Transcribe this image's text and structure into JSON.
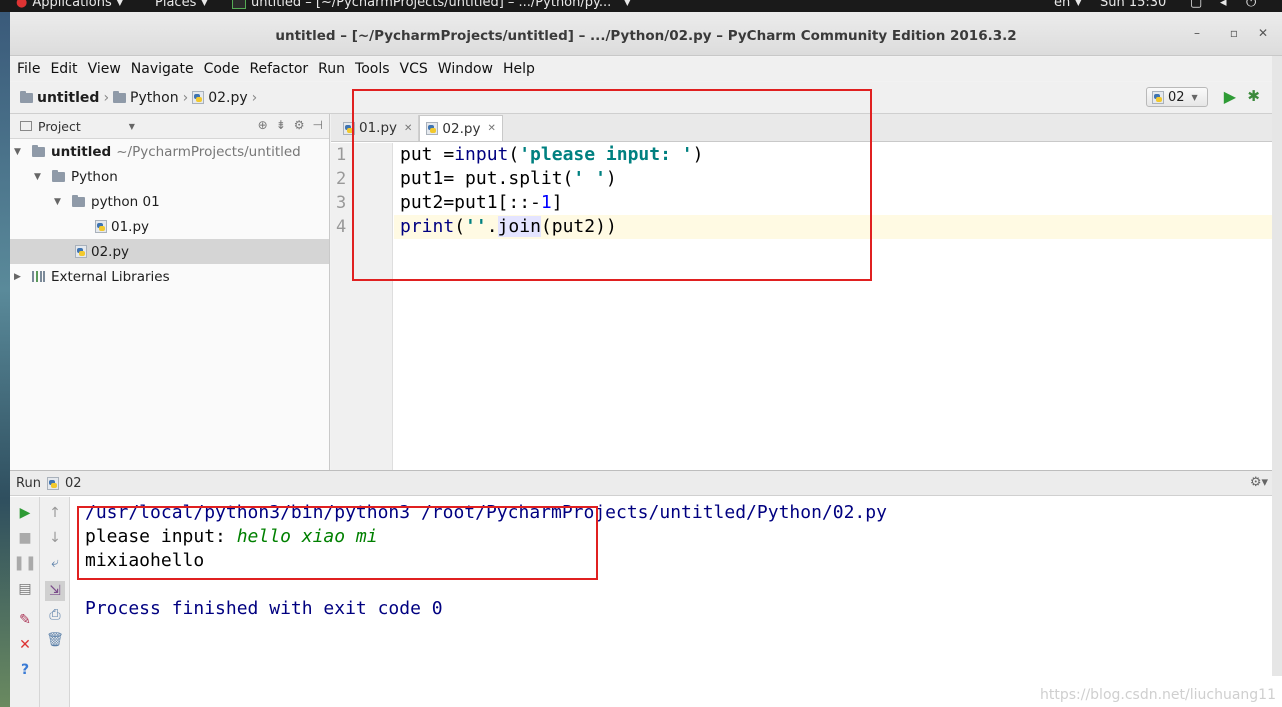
{
  "topbar": {
    "applications": "Applications",
    "places": "Places",
    "task_title": "untitled – [~/PycharmProjects/untitled] – .../Python/py...",
    "lang": "en",
    "clock": "Sun 15:30"
  },
  "window": {
    "title": "untitled – [~/PycharmProjects/untitled] – .../Python/02.py – PyCharm Community Edition 2016.3.2"
  },
  "menu": [
    "File",
    "Edit",
    "View",
    "Navigate",
    "Code",
    "Refactor",
    "Run",
    "Tools",
    "VCS",
    "Window",
    "Help"
  ],
  "breadcrumbs": [
    "untitled",
    "Python",
    "02.py"
  ],
  "run_config": "02",
  "project": {
    "header": "Project",
    "root_name": "untitled",
    "root_path": "~/PycharmProjects/untitled",
    "folder_python": "Python",
    "folder_python01": "python 01",
    "file_01": "01.py",
    "file_02": "02.py",
    "external": "External Libraries"
  },
  "tabs": [
    "01.py",
    "02.py"
  ],
  "editor": {
    "line_numbers": [
      "1",
      "2",
      "3",
      "4"
    ]
  },
  "run": {
    "label": "Run",
    "config": "02",
    "cmd": "/usr/local/python3/bin/python3 /root/PycharmProjects/untitled/Python/02.py",
    "prompt": "please input: ",
    "user_input": "hello xiao mi",
    "output": "mixiaohello",
    "exit": "Process finished with exit code 0"
  },
  "watermark": "https://blog.csdn.net/liuchuang11"
}
